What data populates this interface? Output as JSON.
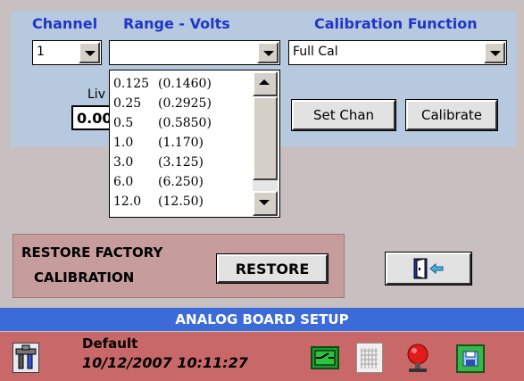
{
  "headers": {
    "channel": "Channel",
    "range": "Range - Volts",
    "calibration": "Calibration Function"
  },
  "channel_value": "1",
  "range_value": "",
  "calibration_value": "Full Cal",
  "live_label": "Liv",
  "live_value": "0.00",
  "range_options": [
    {
      "v": "0.125",
      "p": "(0.1460)"
    },
    {
      "v": "0.25",
      "p": "(0.2925)"
    },
    {
      "v": "0.5",
      "p": "(0.5850)"
    },
    {
      "v": "1.0",
      "p": "(1.170)"
    },
    {
      "v": "3.0",
      "p": "(3.125)"
    },
    {
      "v": "6.0",
      "p": "(6.250)"
    },
    {
      "v": "12.0",
      "p": "(12.50)"
    }
  ],
  "buttons": {
    "set_chan": "Set Chan",
    "calibrate": "Calibrate",
    "restore": "RESTORE"
  },
  "restore_label_1": "RESTORE FACTORY",
  "restore_label_2": "CALIBRATION",
  "title_bar": "ANALOG BOARD SETUP",
  "status": {
    "profile": "Default",
    "datetime": "10/12/2007 10:11:27"
  },
  "icons": [
    "tools-icon",
    "exit-door-icon",
    "switch-icon",
    "list-icon",
    "alarm-icon",
    "save-icon"
  ],
  "colors": {
    "header_text": "#1f36c8",
    "top_panel": "#b7c9df",
    "restore_panel": "#c79c9c",
    "title_bar": "#3a6bd8",
    "status_bar": "#c96868"
  }
}
